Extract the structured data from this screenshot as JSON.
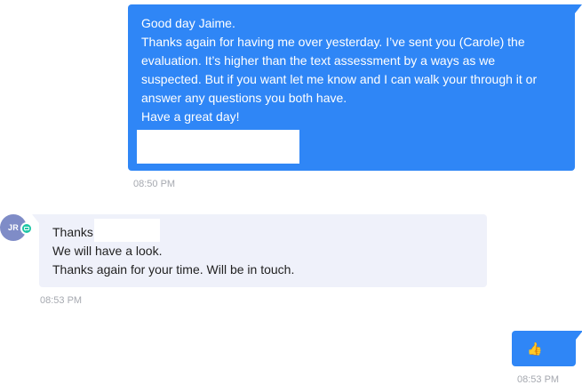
{
  "messages": [
    {
      "direction": "outgoing",
      "lines": [
        "Good day Jaime.",
        "Thanks again for having me over yesterday. I’ve sent you (Carole) the",
        "evaluation. It’s higher than the text assessment by a ways as we",
        "suspected. But if you want let me know and I can walk your through it or",
        "answer any questions you both have.",
        "Have a great day!"
      ],
      "time": "08:50 PM"
    },
    {
      "direction": "incoming",
      "avatar_initials": "JR",
      "lines": [
        "Thanks",
        "We will have a look.",
        "Thanks again for your time. Will be in touch."
      ],
      "time": "08:53 PM"
    },
    {
      "direction": "outgoing",
      "emoji": "👍",
      "emoji_icon": "thumbs-up-icon",
      "time": "08:53 PM"
    }
  ],
  "colors": {
    "outgoing_bubble": "#2f86f6",
    "incoming_bubble": "#eff1fa",
    "avatar": "#7f8cc7",
    "channel_badge": "#20c6a6",
    "timestamp": "#a6a9b0"
  }
}
